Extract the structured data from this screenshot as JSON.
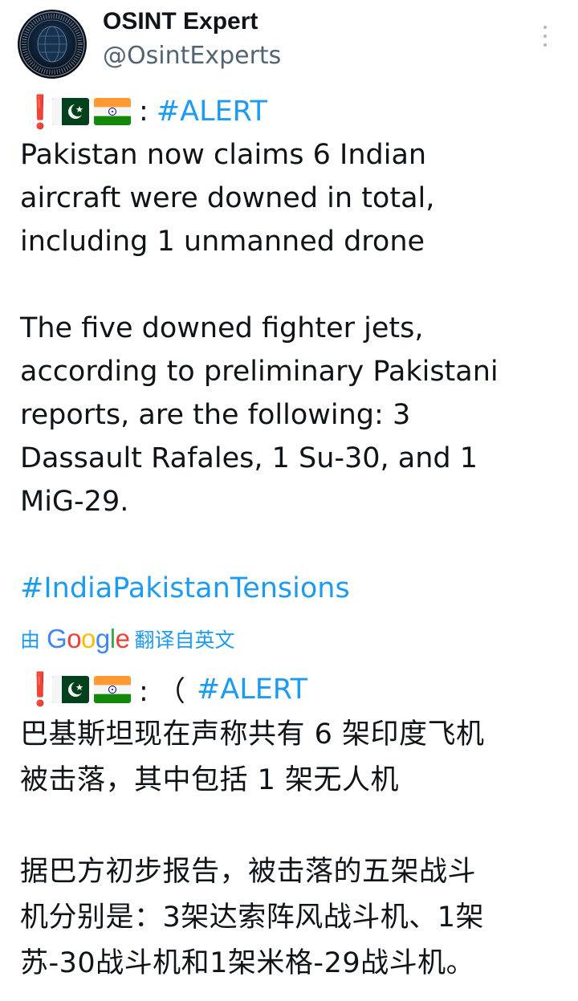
{
  "author": {
    "display_name": "OSINT Expert",
    "handle": "@OsintExperts",
    "avatar_icon": "osint-globe-logo"
  },
  "tweet": {
    "flags": [
      "pakistan-flag",
      "india-flag"
    ],
    "colon": ":",
    "alert_tag": "#ALERT",
    "lines": [
      "Pakistan now claims 6 Indian",
      "aircraft were downed in total,",
      "including 1 unmanned drone"
    ],
    "lines2": [
      "The five downed fighter jets,",
      "according to preliminary Pakistani",
      "reports, are the following: 3",
      "Dassault Rafales, 1 Su-30, and 1",
      "MiG-29."
    ],
    "hashtag": "#IndiaPakistanTensions"
  },
  "translation": {
    "prefix": "由",
    "google_letters": [
      "G",
      "o",
      "o",
      "g",
      "l",
      "e"
    ],
    "suffix": "翻译自英文",
    "colon_paren": ": （",
    "alert_tag": "#ALERT",
    "lines": [
      "巴基斯坦现在声称共有 6 架印度飞机",
      "被击落，其中包括 1 架无人机"
    ],
    "lines2": [
      "据巴方初步报告，被击落的五架战斗",
      "机分别是：3架达索阵风战斗机、1架",
      "苏-30战斗机和1架米格-29战斗机。"
    ]
  },
  "colors": {
    "link": "#1d9bf0",
    "text": "#0f1419",
    "secondary": "#536471",
    "alert_red": "#e0241b"
  }
}
